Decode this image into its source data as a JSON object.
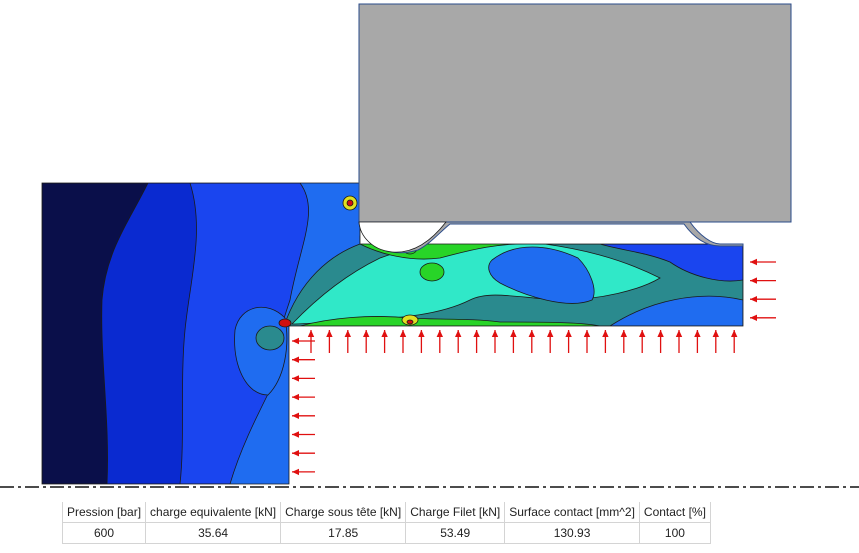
{
  "colors": {
    "contour_dark": "#0a0f4a",
    "contour_blue_deep": "#0a2ad0",
    "contour_blue": "#1a45ef",
    "contour_blue_light": "#1f6cf0",
    "contour_teal": "#2a8a8e",
    "contour_cyan": "#30e8c8",
    "contour_green": "#28d428",
    "contour_yellow": "#e0e020",
    "contour_red": "#d01010",
    "tool": "#a8a8a8",
    "arrows": "#e01010"
  },
  "results_table": {
    "headers": [
      "Pression [bar]",
      "charge equivalente [kN]",
      "Charge sous tête [kN]",
      "Charge Filet [kN]",
      "Surface contact [mm^2]",
      "Contact [%]"
    ],
    "values": [
      "600",
      "35.64",
      "17.85",
      "53.49",
      "130.93",
      "100"
    ]
  }
}
